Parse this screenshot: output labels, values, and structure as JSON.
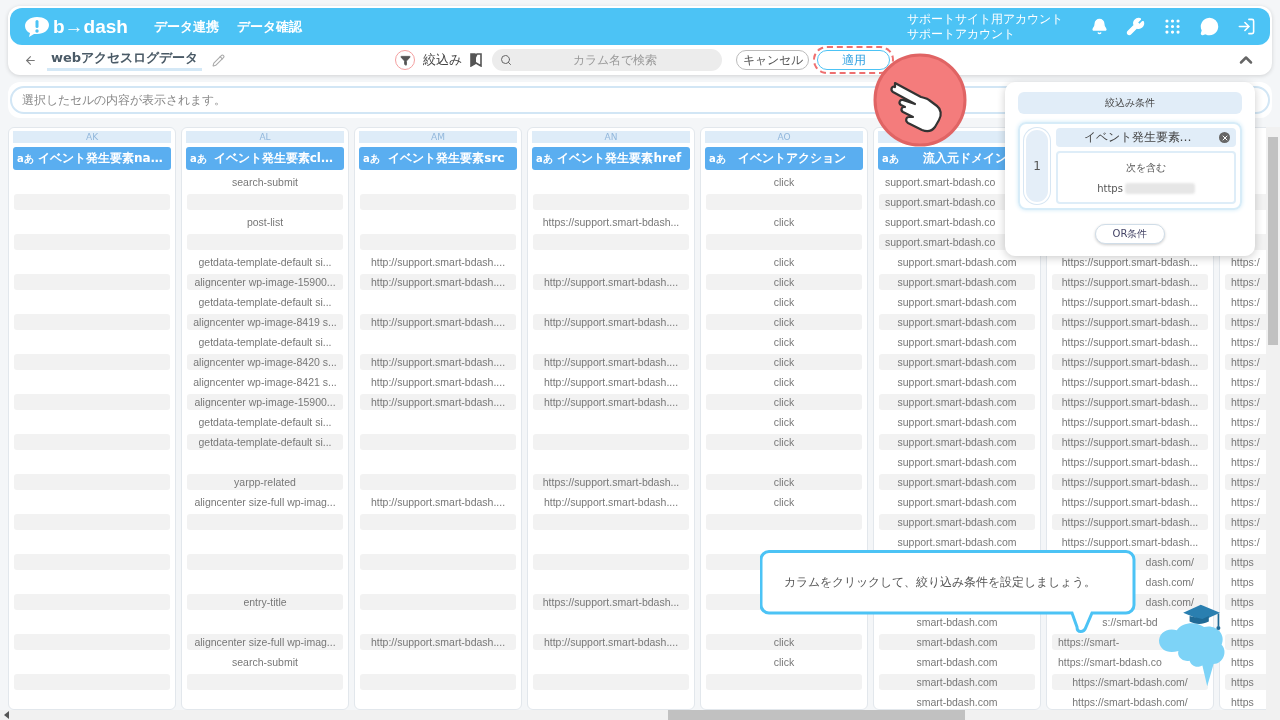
{
  "header": {
    "logo": "b→dash",
    "nav": [
      {
        "label": "データ連携"
      },
      {
        "label": "データ確認"
      }
    ],
    "account": [
      "サポートサイト用アカウント",
      "サポートアカウント"
    ]
  },
  "toolbar": {
    "title": "webアクセスログデータ",
    "filter_label": "絞込み",
    "search": {
      "placeholder": "カラム名で検索"
    },
    "buttons": [
      {
        "label": "キャンセル",
        "highlighted": false
      },
      {
        "label": "適用",
        "highlighted": true
      }
    ]
  },
  "cell_viewer": {
    "placeholder": "選択したセルの内容が表示されます。"
  },
  "columns": [
    {
      "letter": "AK",
      "badge": "aあ",
      "title": "イベント発生要素na…",
      "cells": [
        null,
        null,
        null,
        null,
        null,
        null,
        null,
        null,
        null,
        null,
        null,
        null,
        null,
        null,
        null,
        null,
        null,
        null,
        null,
        null,
        null,
        null,
        null,
        null,
        null,
        null,
        null
      ]
    },
    {
      "letter": "AL",
      "badge": "aあ",
      "title": "イベント発生要素cl…",
      "cells": [
        "search-submit",
        null,
        "post-list",
        null,
        "getdata-template-default si...",
        "aligncenter wp-image-15900...",
        "getdata-template-default si...",
        "aligncenter wp-image-8419 s...",
        "getdata-template-default si...",
        "aligncenter wp-image-8420 s...",
        "aligncenter wp-image-8421 s...",
        "aligncenter wp-image-15900...",
        "getdata-template-default si...",
        "getdata-template-default si...",
        null,
        "yarpp-related",
        "aligncenter size-full wp-imag...",
        null,
        null,
        null,
        null,
        "entry-title",
        null,
        "aligncenter size-full wp-imag...",
        "search-submit",
        null,
        null
      ]
    },
    {
      "letter": "AM",
      "badge": "aあ",
      "title": "イベント発生要素src",
      "cells": [
        null,
        null,
        null,
        null,
        "http://support.smart-bdash....",
        "http://support.smart-bdash....",
        null,
        "http://support.smart-bdash....",
        null,
        "http://support.smart-bdash....",
        "http://support.smart-bdash....",
        "http://support.smart-bdash....",
        null,
        null,
        null,
        null,
        "http://support.smart-bdash....",
        null,
        null,
        null,
        null,
        null,
        null,
        "http://support.smart-bdash....",
        null,
        null,
        null
      ]
    },
    {
      "letter": "AN",
      "badge": "aあ",
      "title": "イベント発生要素href",
      "cells": [
        null,
        null,
        "https://support.smart-bdash...",
        null,
        null,
        "http://support.smart-bdash....",
        null,
        "http://support.smart-bdash....",
        null,
        "http://support.smart-bdash....",
        "http://support.smart-bdash....",
        "http://support.smart-bdash....",
        null,
        null,
        null,
        "https://support.smart-bdash...",
        "http://support.smart-bdash....",
        null,
        null,
        null,
        null,
        "https://support.smart-bdash...",
        null,
        "http://support.smart-bdash....",
        null,
        null,
        null
      ]
    },
    {
      "letter": "AO",
      "badge": "aあ",
      "title": "イベントアクション",
      "cells": [
        "click",
        null,
        "click",
        null,
        "click",
        "click",
        "click",
        "click",
        "click",
        "click",
        "click",
        "click",
        "click",
        "click",
        null,
        "click",
        "click",
        null,
        null,
        null,
        null,
        null,
        null,
        "click",
        "click",
        null,
        null
      ]
    },
    {
      "badge": "aあ",
      "title": "流入元ドメイン",
      "cells": [
        {
          "text": "support.smart-bdash.co",
          "cut_right": true
        },
        {
          "text": "support.smart-bdash.co",
          "cut_right": true
        },
        {
          "text": "support.smart-bdash.co",
          "cut_right": true
        },
        {
          "text": "support.smart-bdash.co",
          "cut_right": true
        },
        "support.smart-bdash.com",
        "support.smart-bdash.com",
        "support.smart-bdash.com",
        "support.smart-bdash.com",
        "support.smart-bdash.com",
        "support.smart-bdash.com",
        "support.smart-bdash.com",
        "support.smart-bdash.com",
        "support.smart-bdash.com",
        "support.smart-bdash.com",
        "support.smart-bdash.com",
        "support.smart-bdash.com",
        "support.smart-bdash.com",
        "support.smart-bdash.com",
        "support.smart-bdash.com",
        null,
        null,
        null,
        "smart-bdash.com",
        "smart-bdash.com",
        "smart-bdash.com",
        "smart-bdash.com",
        "smart-bdash.com"
      ]
    },
    {
      "cells": [
        null,
        null,
        null,
        null,
        "https://support.smart-bdash...",
        "https://support.smart-bdash...",
        "https://support.smart-bdash...",
        "https://support.smart-bdash...",
        "https://support.smart-bdash...",
        "https://support.smart-bdash...",
        "https://support.smart-bdash...",
        "https://support.smart-bdash...",
        "https://support.smart-bdash...",
        "https://support.smart-bdash...",
        "https://support.smart-bdash...",
        "https://support.smart-bdash...",
        "https://support.smart-bdash...",
        "https://support.smart-bdash...",
        "https://support.smart-bdash...",
        {
          "text": "dash.com/",
          "cut_left": true
        },
        {
          "text": "dash.com/",
          "cut_left": true
        },
        {
          "text": "dash.com/",
          "cut_left": true
        },
        "s://smart-bd",
        {
          "text": "https://smart-",
          "cut_right": true
        },
        {
          "text": "https://smart-bdash.co",
          "cut_right": true
        },
        "https://smart-bdash.com/",
        "https://smart-bdash.com/"
      ]
    },
    {
      "cut_right": true,
      "cells": [
        null,
        null,
        null,
        null,
        "https:/",
        "https:/",
        "https:/",
        "https:/",
        "https:/",
        "https:/",
        "https:/",
        "https:/",
        "https:/",
        "https:/",
        "https:/",
        "https:/",
        "https:/",
        "https:/",
        "https:/",
        "https",
        "https",
        "https",
        "https",
        "https",
        "https",
        "https",
        "https"
      ]
    }
  ],
  "filter_panel": {
    "title": "絞込み条件",
    "conditions": [
      {
        "number": "1",
        "field": "イベント発生要素…",
        "operator": "次を含む",
        "value": "https"
      }
    ],
    "or_button": "OR条件"
  },
  "tip": {
    "text": "カラムをクリックして、絞り込み条件を設定しましょう。"
  }
}
